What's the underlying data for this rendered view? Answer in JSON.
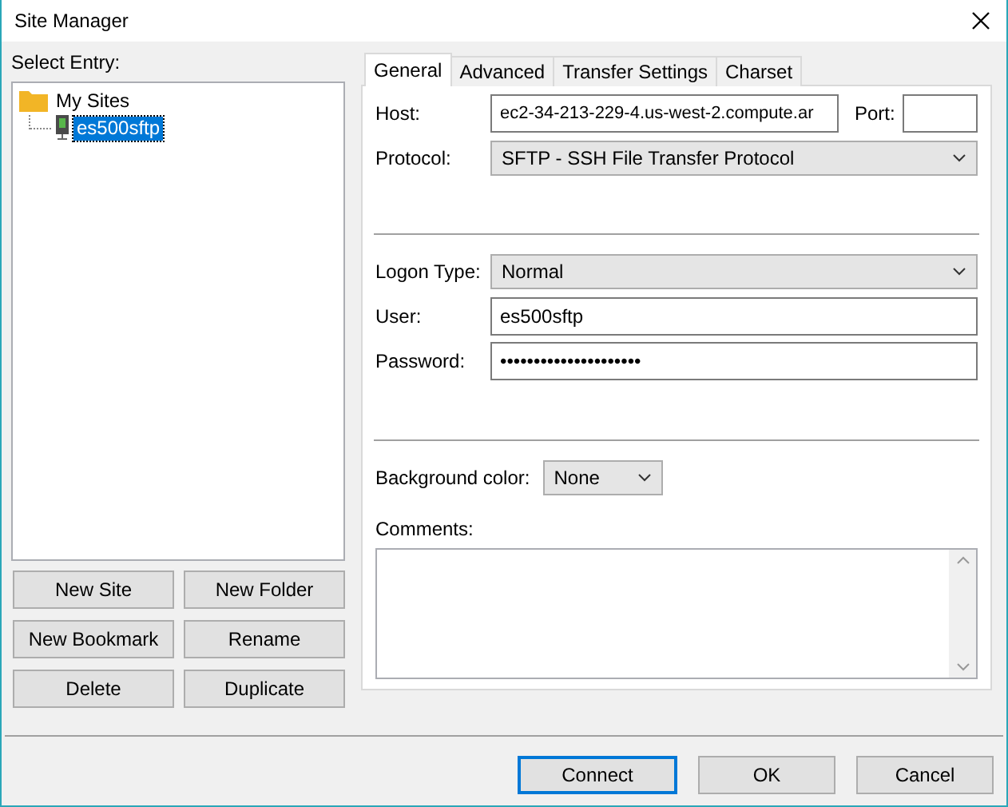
{
  "window": {
    "title": "Site Manager"
  },
  "select_entry": {
    "label": "Select Entry:"
  },
  "tree": [
    {
      "label": "My Sites",
      "kind": "folder",
      "selected": false,
      "children": [
        {
          "label": "es500sftp",
          "kind": "server",
          "selected": true
        }
      ]
    }
  ],
  "site_buttons": [
    "New Site",
    "New Folder",
    "New Bookmark",
    "Rename",
    "Delete",
    "Duplicate"
  ],
  "tabs": [
    {
      "label": "General",
      "selected": true
    },
    {
      "label": "Advanced",
      "selected": false
    },
    {
      "label": "Transfer Settings",
      "selected": false
    },
    {
      "label": "Charset",
      "selected": false
    }
  ],
  "host": {
    "label": "Host:",
    "value": "ec2-34-213-229-4.us-west-2.compute.ar"
  },
  "port": {
    "label": "Port:"
  },
  "protocol": {
    "label": "Protocol:",
    "value": "SFTP - SSH File Transfer Protocol"
  },
  "logon_type": {
    "label": "Logon Type:",
    "value": "Normal"
  },
  "user": {
    "label": "User:",
    "value": "es500sftp"
  },
  "password": {
    "label": "Password:",
    "value": "•••••••••••••••••••••"
  },
  "background_color": {
    "label": "Background color:",
    "value": "None"
  },
  "comments": {
    "label": "Comments:"
  },
  "footer_buttons": [
    {
      "label": "Connect",
      "focused": true
    },
    {
      "label": "OK",
      "focused": false
    },
    {
      "label": "Cancel",
      "focused": false
    }
  ]
}
